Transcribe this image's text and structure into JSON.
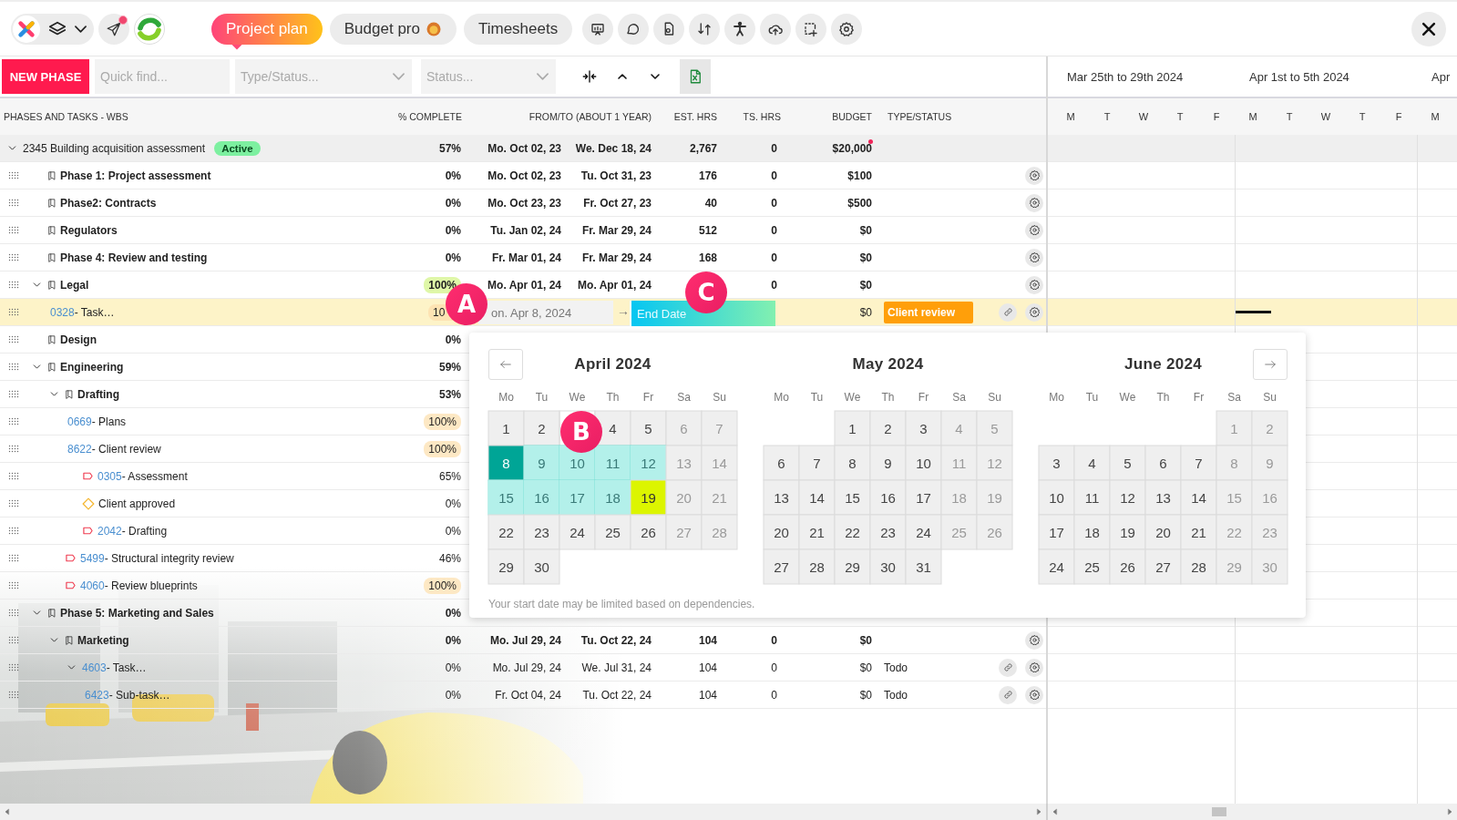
{
  "top_bar": {
    "notification": true,
    "tabs": [
      {
        "label": "Project plan",
        "selected": true
      },
      {
        "label": "Budget pro",
        "kind": "lion",
        "selected": false
      },
      {
        "label": "Timesheets",
        "selected": false
      }
    ]
  },
  "toolbar": {
    "new_button": "NEW PHASE",
    "search": {
      "placeholder": "Quick find..."
    },
    "type_filter": {
      "placeholder": "Type/Status..."
    },
    "status_filter": {
      "placeholder": "Status..."
    }
  },
  "table": {
    "columns": [
      "PHASES AND TASKS - WBS",
      "% COMPLETE",
      "FROM/TO (ABOUT 1 YEAR)",
      "EST. HRS",
      "TS. HRS",
      "BUDGET",
      "TYPE/STATUS"
    ],
    "project": {
      "kind": "project",
      "expanded": true,
      "name": "2345 Building acquisition assessment",
      "badge": "Active",
      "pct": {
        "text": "57%"
      },
      "from": "Mo. Oct 02, 23",
      "to": "We. Dec 18, 24",
      "est": "2,767",
      "ts": "0",
      "budget": "$20,000",
      "budget_alert": true,
      "children": [
        {
          "kind": "phase",
          "name": "Phase 1: Project assessment",
          "pct": {
            "text": "0%"
          },
          "from": "Mo. Oct 02, 23",
          "to": "Tu. Oct 31, 23",
          "est": "176",
          "ts": "0",
          "budget": "$100",
          "actions": [
            {
              "kind": "settings"
            }
          ],
          "selected": false
        },
        {
          "kind": "phase",
          "name": "Phase2: Contracts",
          "pct": {
            "text": "0%"
          },
          "from": "Mo. Oct 23, 23",
          "to": "Fr. Oct 27, 23",
          "est": "40",
          "ts": "0",
          "budget": "$500",
          "actions": [
            {
              "kind": "settings"
            }
          ],
          "selected": false
        },
        {
          "kind": "phase",
          "name": "Regulators",
          "pct": {
            "text": "0%"
          },
          "from": "Tu. Jan 02, 24",
          "to": "Fr. Mar 29, 24",
          "est": "512",
          "ts": "0",
          "budget": "$0",
          "actions": [
            {
              "kind": "settings"
            }
          ],
          "selected": false
        },
        {
          "kind": "phase",
          "name": "Phase 4: Review and testing",
          "pct": {
            "text": "0%"
          },
          "from": "Fr. Mar 01, 24",
          "to": "Fr. Mar 29, 24",
          "est": "168",
          "ts": "0",
          "budget": "$0",
          "actions": [
            {
              "kind": "settings"
            }
          ],
          "selected": false
        },
        {
          "kind": "phase",
          "name": "Legal",
          "expanded": true,
          "pct": {
            "text": "100%",
            "color": "#dff7a8"
          },
          "from": "Mo. Apr 01, 24",
          "to": "Mo. Apr 01, 24",
          "ts": "0",
          "budget": "$0",
          "actions": [
            {
              "kind": "settings"
            }
          ],
          "selected": false,
          "children": [
            {
              "kind": "task",
              "code": "0328",
              "name": "- Task…",
              "pct": {
                "text": "10",
                "color": "#fde3b3"
              },
              "budget": "$0",
              "status": {
                "text": "Client review",
                "kind": "badge"
              },
              "actions": [
                {
                  "kind": "link"
                },
                {
                  "kind": "settings"
                }
              ],
              "selected": true
            }
          ]
        },
        {
          "kind": "phase",
          "name": "Design",
          "pct": {
            "text": "0%"
          },
          "selected": false
        },
        {
          "kind": "phase",
          "name": "Engineering",
          "expanded": true,
          "pct": {
            "text": "59%"
          },
          "selected": false,
          "children": [
            {
              "kind": "phase",
              "name": "Drafting",
              "expanded": true,
              "pct": {
                "text": "53%"
              },
              "selected": false,
              "children": [
                {
                  "kind": "task",
                  "code": "0669",
                  "name": "- Plans",
                  "pct": {
                    "text": "100%",
                    "color": "#fde8c4"
                  },
                  "selected": false
                },
                {
                  "kind": "task",
                  "code": "8622",
                  "name": "- Client review",
                  "pct": {
                    "text": "100%",
                    "color": "#fde8c4"
                  },
                  "selected": false
                },
                {
                  "kind": "flagged",
                  "code": "0305",
                  "name": "- Assessment",
                  "pct": {
                    "text": "65%"
                  },
                  "selected": false
                },
                {
                  "kind": "milestone",
                  "name": "Client approved",
                  "pct": {
                    "text": "0%"
                  },
                  "selected": false
                },
                {
                  "kind": "flagged",
                  "code": "2042",
                  "name": "- Drafting",
                  "pct": {
                    "text": "0%"
                  },
                  "selected": false
                }
              ]
            },
            {
              "kind": "flagged",
              "code": "5499",
              "name": "- Structural integrity review",
              "pct": {
                "text": "46%"
              },
              "selected": false
            },
            {
              "kind": "flagged",
              "code": "4060",
              "name": "- Review blueprints",
              "pct": {
                "text": "100%",
                "color": "#fde8c4"
              },
              "selected": false
            }
          ]
        },
        {
          "kind": "phase",
          "name": "Phase 5: Marketing and Sales",
          "expanded": true,
          "pct": {
            "text": "0%"
          },
          "selected": false,
          "children": [
            {
              "kind": "phase",
              "name": "Marketing",
              "expanded": true,
              "pct": {
                "text": "0%"
              },
              "from": "Mo. Jul 29, 24",
              "to": "Tu. Oct 22, 24",
              "est": "104",
              "ts": "0",
              "budget": "$0",
              "actions": [
                {
                  "kind": "settings"
                }
              ],
              "selected": false,
              "children": [
                {
                  "kind": "task",
                  "code": "4603",
                  "name": "- Task…",
                  "expanded": true,
                  "pct": {
                    "text": "0%"
                  },
                  "from": "Mo. Jul 29, 24",
                  "to": "We. Jul 31, 24",
                  "est": "104",
                  "ts": "0",
                  "budget": "$0",
                  "status": {
                    "text": "Todo",
                    "kind": "plain"
                  },
                  "actions": [
                    {
                      "kind": "link"
                    },
                    {
                      "kind": "settings"
                    }
                  ],
                  "selected": false,
                  "children": [
                    {
                      "kind": "task",
                      "code": "6423",
                      "name": "- Sub-task…",
                      "pct": {
                        "text": "0%"
                      },
                      "from": "Fr. Oct 04, 24",
                      "to": "Tu. Oct 22, 24",
                      "est": "104",
                      "ts": "0",
                      "budget": "$0",
                      "status": {
                        "text": "Todo",
                        "kind": "plain"
                      },
                      "actions": [
                        {
                          "kind": "link"
                        },
                        {
                          "kind": "settings"
                        }
                      ],
                      "selected": false
                    }
                  ]
                }
              ]
            }
          ]
        }
      ]
    }
  },
  "timeline": {
    "weeks": [
      "Mar 25th to 29th 2024",
      "Apr 1st to 5th 2024",
      "Apr"
    ],
    "days": [
      "M",
      "T",
      "W",
      "T",
      "F",
      "M",
      "T",
      "W",
      "T",
      "F",
      "M"
    ]
  },
  "date_editor": {
    "start_value": "on. Apr 8, 2024",
    "separator": "→",
    "end_placeholder": "End Date"
  },
  "markers": [
    {
      "label": "A"
    },
    {
      "label": "B"
    },
    {
      "label": "C"
    }
  ],
  "calendar": {
    "note": "Your start date may be limited based on dependencies.",
    "months": [
      {
        "title": "April 2024",
        "weekdays": [
          "Mo",
          "Tu",
          "We",
          "Th",
          "Fr",
          "Sa",
          "Su"
        ],
        "days": [
          {
            "day": "1",
            "kind": "day"
          },
          {
            "day": "2",
            "kind": "day"
          },
          {
            "kind": "day"
          },
          {
            "day": "4",
            "kind": "day"
          },
          {
            "day": "5",
            "kind": "day"
          },
          {
            "day": "6",
            "kind": "weekend"
          },
          {
            "day": "7",
            "kind": "weekend"
          },
          {
            "day": "8",
            "kind": "start"
          },
          {
            "day": "9",
            "kind": "range"
          },
          {
            "day": "10",
            "kind": "range"
          },
          {
            "day": "11",
            "kind": "range"
          },
          {
            "day": "12",
            "kind": "range"
          },
          {
            "day": "13",
            "kind": "weekend"
          },
          {
            "day": "14",
            "kind": "weekend"
          },
          {
            "day": "15",
            "kind": "range"
          },
          {
            "day": "16",
            "kind": "range"
          },
          {
            "day": "17",
            "kind": "range"
          },
          {
            "day": "18",
            "kind": "range"
          },
          {
            "day": "19",
            "kind": "end"
          },
          {
            "day": "20",
            "kind": "weekend"
          },
          {
            "day": "21",
            "kind": "weekend"
          },
          {
            "day": "22",
            "kind": "day"
          },
          {
            "day": "23",
            "kind": "day"
          },
          {
            "day": "24",
            "kind": "day"
          },
          {
            "day": "25",
            "kind": "day"
          },
          {
            "day": "26",
            "kind": "day"
          },
          {
            "day": "27",
            "kind": "weekend"
          },
          {
            "day": "28",
            "kind": "weekend"
          },
          {
            "day": "29",
            "kind": "day"
          },
          {
            "day": "30",
            "kind": "day"
          }
        ]
      },
      {
        "title": "May 2024",
        "weekdays": [
          "Mo",
          "Tu",
          "We",
          "Th",
          "Fr",
          "Sa",
          "Su"
        ],
        "days": [
          {
            "kind": "blank"
          },
          {
            "kind": "blank"
          },
          {
            "day": "1",
            "kind": "day"
          },
          {
            "day": "2",
            "kind": "day"
          },
          {
            "day": "3",
            "kind": "day"
          },
          {
            "day": "4",
            "kind": "weekend"
          },
          {
            "day": "5",
            "kind": "weekend"
          },
          {
            "day": "6",
            "kind": "day"
          },
          {
            "day": "7",
            "kind": "day"
          },
          {
            "day": "8",
            "kind": "day"
          },
          {
            "day": "9",
            "kind": "day"
          },
          {
            "day": "10",
            "kind": "day"
          },
          {
            "day": "11",
            "kind": "weekend"
          },
          {
            "day": "12",
            "kind": "weekend"
          },
          {
            "day": "13",
            "kind": "day"
          },
          {
            "day": "14",
            "kind": "day"
          },
          {
            "day": "15",
            "kind": "day"
          },
          {
            "day": "16",
            "kind": "day"
          },
          {
            "day": "17",
            "kind": "day"
          },
          {
            "day": "18",
            "kind": "weekend"
          },
          {
            "day": "19",
            "kind": "weekend"
          },
          {
            "day": "20",
            "kind": "day"
          },
          {
            "day": "21",
            "kind": "day"
          },
          {
            "day": "22",
            "kind": "day"
          },
          {
            "day": "23",
            "kind": "day"
          },
          {
            "day": "24",
            "kind": "day"
          },
          {
            "day": "25",
            "kind": "weekend"
          },
          {
            "day": "26",
            "kind": "weekend"
          },
          {
            "day": "27",
            "kind": "day"
          },
          {
            "day": "28",
            "kind": "day"
          },
          {
            "day": "29",
            "kind": "day"
          },
          {
            "day": "30",
            "kind": "day"
          },
          {
            "day": "31",
            "kind": "day"
          }
        ]
      },
      {
        "title": "June 2024",
        "weekdays": [
          "Mo",
          "Tu",
          "We",
          "Th",
          "Fr",
          "Sa",
          "Su"
        ],
        "days": [
          {
            "kind": "blank"
          },
          {
            "kind": "blank"
          },
          {
            "kind": "blank"
          },
          {
            "kind": "blank"
          },
          {
            "kind": "blank"
          },
          {
            "day": "1",
            "kind": "weekend"
          },
          {
            "day": "2",
            "kind": "weekend"
          },
          {
            "day": "3",
            "kind": "day"
          },
          {
            "day": "4",
            "kind": "day"
          },
          {
            "day": "5",
            "kind": "day"
          },
          {
            "day": "6",
            "kind": "day"
          },
          {
            "day": "7",
            "kind": "day"
          },
          {
            "day": "8",
            "kind": "weekend"
          },
          {
            "day": "9",
            "kind": "weekend"
          },
          {
            "day": "10",
            "kind": "day"
          },
          {
            "day": "11",
            "kind": "day"
          },
          {
            "day": "12",
            "kind": "day"
          },
          {
            "day": "13",
            "kind": "day"
          },
          {
            "day": "14",
            "kind": "day"
          },
          {
            "day": "15",
            "kind": "weekend"
          },
          {
            "day": "16",
            "kind": "weekend"
          },
          {
            "day": "17",
            "kind": "day"
          },
          {
            "day": "18",
            "kind": "day"
          },
          {
            "day": "19",
            "kind": "day"
          },
          {
            "day": "20",
            "kind": "day"
          },
          {
            "day": "21",
            "kind": "day"
          },
          {
            "day": "22",
            "kind": "weekend"
          },
          {
            "day": "23",
            "kind": "weekend"
          },
          {
            "day": "24",
            "kind": "day"
          },
          {
            "day": "25",
            "kind": "day"
          },
          {
            "day": "26",
            "kind": "day"
          },
          {
            "day": "27",
            "kind": "day"
          },
          {
            "day": "28",
            "kind": "day"
          },
          {
            "day": "29",
            "kind": "weekend"
          },
          {
            "day": "30",
            "kind": "weekend"
          }
        ]
      }
    ]
  }
}
